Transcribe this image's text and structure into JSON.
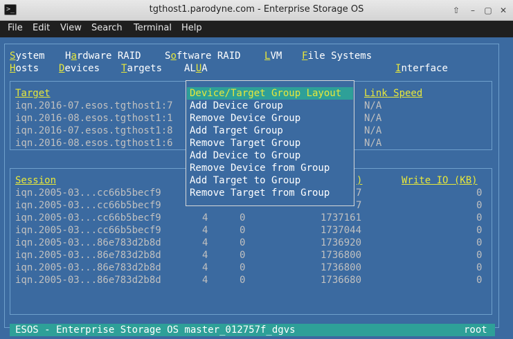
{
  "window": {
    "title": "tgthost1.parodyne.com - Enterprise Storage OS",
    "app_icon_glyph": ">_",
    "buttons": [
      "⇧",
      "–",
      "▢",
      "✕"
    ]
  },
  "menubar": [
    "File",
    "Edit",
    "View",
    "Search",
    "Terminal",
    "Help"
  ],
  "tui_menu": {
    "row1": [
      {
        "hot": "S",
        "rest": "ystem"
      },
      {
        "pre": "H",
        "hot": "a",
        "rest": "rdware RAID"
      },
      {
        "pre": "S",
        "hot": "o",
        "rest": "ftware RAID"
      },
      {
        "hot": "L",
        "rest": "VM"
      },
      {
        "hot": "F",
        "rest": "ile Systems"
      }
    ],
    "row2": [
      {
        "hot": "H",
        "rest": "osts"
      },
      {
        "hot": "D",
        "rest": "evices"
      },
      {
        "hot": "T",
        "rest": "argets"
      },
      {
        "pre": "AL",
        "hot": "U",
        "rest": "A"
      },
      {
        "hot": "I",
        "rest": "nterface"
      }
    ]
  },
  "targets_table": {
    "headers": {
      "target": "Target",
      "link_speed": "Link Speed"
    },
    "rows": [
      {
        "target": "iqn.2016-07.esos.tgthost1:7",
        "speed": "N/A"
      },
      {
        "target": "iqn.2016-08.esos.tgthost1:1",
        "speed": "N/A"
      },
      {
        "target": "iqn.2016-07.esos.tgthost1:8",
        "speed": "N/A"
      },
      {
        "target": "iqn.2016-08.esos.tgthost1:6",
        "speed": "N/A"
      }
    ]
  },
  "sessions_table": {
    "headers": {
      "session": "Session",
      "read_tail": ")",
      "write": "Write IO (KB)"
    },
    "rows": [
      {
        "session": "iqn.2005-03...cc66b5becf9",
        "c2": "",
        "c3": "",
        "read": "7",
        "write": "0"
      },
      {
        "session": "iqn.2005-03...cc66b5becf9",
        "c2": "",
        "c3": "",
        "read": "7",
        "write": "0"
      },
      {
        "session": "iqn.2005-03...cc66b5becf9",
        "c2": "4",
        "c3": "0",
        "read": "1737161",
        "write": "0"
      },
      {
        "session": "iqn.2005-03...cc66b5becf9",
        "c2": "4",
        "c3": "0",
        "read": "1737044",
        "write": "0"
      },
      {
        "session": "iqn.2005-03...86e783d2b8d",
        "c2": "4",
        "c3": "0",
        "read": "1736920",
        "write": "0"
      },
      {
        "session": "iqn.2005-03...86e783d2b8d",
        "c2": "4",
        "c3": "0",
        "read": "1736800",
        "write": "0"
      },
      {
        "session": "iqn.2005-03...86e783d2b8d",
        "c2": "4",
        "c3": "0",
        "read": "1736800",
        "write": "0"
      },
      {
        "session": "iqn.2005-03...86e783d2b8d",
        "c2": "4",
        "c3": "0",
        "read": "1736680",
        "write": "0"
      }
    ]
  },
  "alua_popup": {
    "items": [
      "Device/Target Group Layout",
      "Add Device Group",
      "Remove Device Group",
      "Add Target Group",
      "Remove Target Group",
      "Add Device to Group",
      "Remove Device from Group",
      "Add Target to Group",
      "Remove Target from Group"
    ],
    "selected_index": 0
  },
  "status": {
    "left": "ESOS - Enterprise Storage OS master_012757f_dgvs",
    "right": "root"
  },
  "colors": {
    "terminal_bg": "#3b6aa0",
    "accent_teal": "#2ea098",
    "hotkey_yellow": "#e8e83a",
    "box_border": "#6fa0cc"
  }
}
